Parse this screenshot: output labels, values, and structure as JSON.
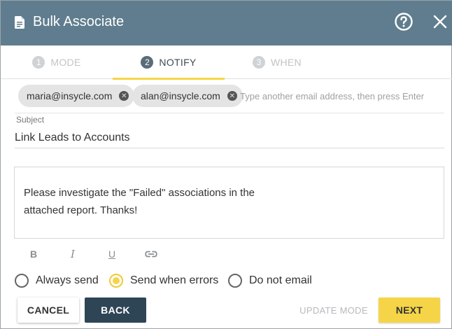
{
  "header": {
    "title": "Bulk Associate",
    "icon": "document-icon",
    "help_icon": "help-circle-icon",
    "close_icon": "close-icon",
    "bg_color": "#5f7d8e"
  },
  "steps": [
    {
      "number": "1",
      "label": "MODE",
      "active": false
    },
    {
      "number": "2",
      "label": "NOTIFY",
      "active": true
    },
    {
      "number": "3",
      "label": "WHEN",
      "active": false
    }
  ],
  "recipients": {
    "chips": [
      "maria@insycle.com",
      "alan@insycle.com"
    ],
    "placeholder": "Type another email address, then press Enter"
  },
  "subject": {
    "label": "Subject",
    "value": "Link Leads to Accounts"
  },
  "message": {
    "lines": [
      "Please investigate the \"Failed\" associations in the",
      "attached report. Thanks!"
    ]
  },
  "format_toolbar": {
    "bold": "B",
    "italic": "I",
    "underline": "U",
    "link_icon": "link-icon"
  },
  "send_options": {
    "options": [
      "Always send",
      "Send when errors",
      "Do not email"
    ],
    "selected": "Send when errors"
  },
  "footer": {
    "cancel": "CANCEL",
    "back": "BACK",
    "update_mode": "UPDATE MODE",
    "next": "NEXT"
  },
  "colors": {
    "accent": "#f5d547",
    "primary_dark": "#2e4556"
  }
}
